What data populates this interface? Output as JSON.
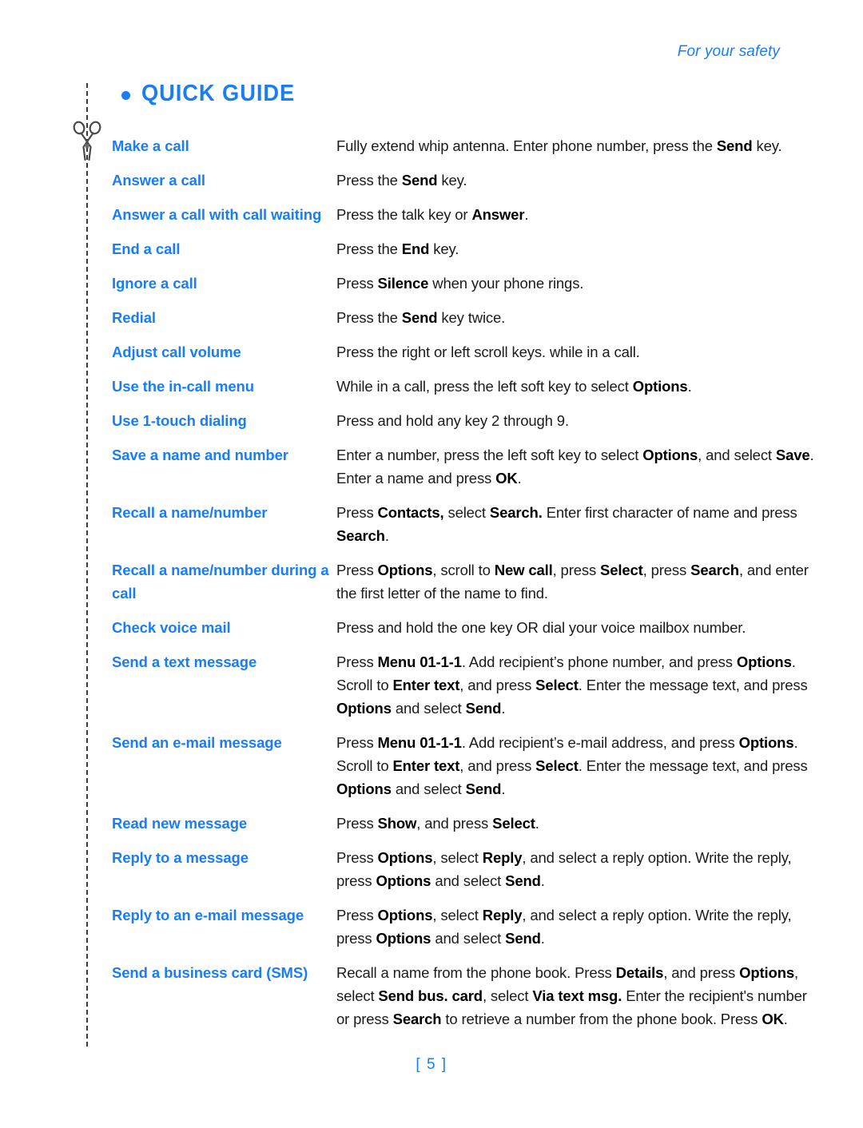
{
  "header": {
    "running_head": "For your safety"
  },
  "title": {
    "bullet": "bullet-glyph",
    "text": "QUICK GUIDE"
  },
  "margin": {
    "scissors_icon": "scissors-icon",
    "cut_line": "dashed-cut-line"
  },
  "guide": {
    "rows": [
      {
        "action": "Make a call",
        "steps_html": "Fully extend whip antenna. Enter phone number, press the <b>Send</b> key."
      },
      {
        "action": "Answer a call",
        "steps_html": "Press the <b>Send</b> key."
      },
      {
        "action": "Answer a call with call waiting",
        "steps_html": "Press the talk key or <b>Answer</b>."
      },
      {
        "action": "End a call",
        "steps_html": "Press the <b>End</b> key."
      },
      {
        "action": "Ignore a call",
        "steps_html": "Press <b>Silence</b> when your phone rings."
      },
      {
        "action": "Redial",
        "steps_html": "Press the <b>Send</b> key twice."
      },
      {
        "action": "Adjust call volume",
        "steps_html": "Press the right or left scroll keys. while in a call."
      },
      {
        "action": "Use the in-call menu",
        "steps_html": "While in a call, press the left soft key to select <b>Options</b>."
      },
      {
        "action": "Use 1-touch dialing",
        "steps_html": "Press and hold any key 2 through 9."
      },
      {
        "action": "Save a name and number",
        "steps_html": "Enter a number, press the left soft key to select <b>Options</b>, and select <b>Save</b>. Enter a name and press <b>OK</b>."
      },
      {
        "action": "Recall a name/number",
        "steps_html": "Press <b>Contacts,</b> select <b>Search.</b> Enter first character of name and press <b>Search</b>."
      },
      {
        "action": "Recall a name/number during a call",
        "steps_html": "Press <b>Options</b>, scroll to <b>New call</b>, press <b>Select</b>, press <b>Search</b>, and enter the first letter of the name to find."
      },
      {
        "action": "Check voice mail",
        "steps_html": "Press and hold the one key OR dial your voice mailbox number."
      },
      {
        "action": "Send a text message",
        "steps_html": "Press <b>Menu 01-1-1</b>. Add recipient&rsquo;s phone number, and press <b>Options</b>. Scroll to <b>Enter text</b>, and press <b>Select</b>. Enter the message text, and press <b>Options</b> and select <b>Send</b>."
      },
      {
        "action": "Send an e-mail message",
        "steps_html": "Press <b>Menu 01-1-1</b>. Add recipient&rsquo;s e-mail address, and press <b>Options</b>. Scroll to <b>Enter text</b>, and press <b>Select</b>. Enter the message text, and press <b>Options</b> and select <b>Send</b>."
      },
      {
        "action": "Read new message",
        "steps_html": "Press <b>Show</b>, and press <b>Select</b>."
      },
      {
        "action": "Reply to a message",
        "steps_html": "Press <b>Options</b>, select <b>Reply</b>, and select a reply option. Write the reply, press <b>Options</b> and select <b>Send</b>."
      },
      {
        "action": "Reply to an e-mail message",
        "steps_html": "Press <b>Options</b>, select <b>Reply</b>, and select a reply option. Write the reply, press <b>Options</b> and select <b>Send</b>."
      },
      {
        "action": "Send a business card (SMS)",
        "steps_html": "Recall a name from the phone book. Press <b>Details</b>, and press <b>Options</b>, select <b>Send bus. card</b>, select <b>Via text msg.</b> Enter the recipient's number or press <b>Search</b> to retrieve a number from the phone book. Press <b>OK</b>."
      }
    ]
  },
  "footer": {
    "page_number": "[ 5 ]"
  },
  "colors": {
    "accent_blue": "#1a7ef2",
    "body_text": "#1b1b1b",
    "cut_line": "#3b3b3b"
  }
}
